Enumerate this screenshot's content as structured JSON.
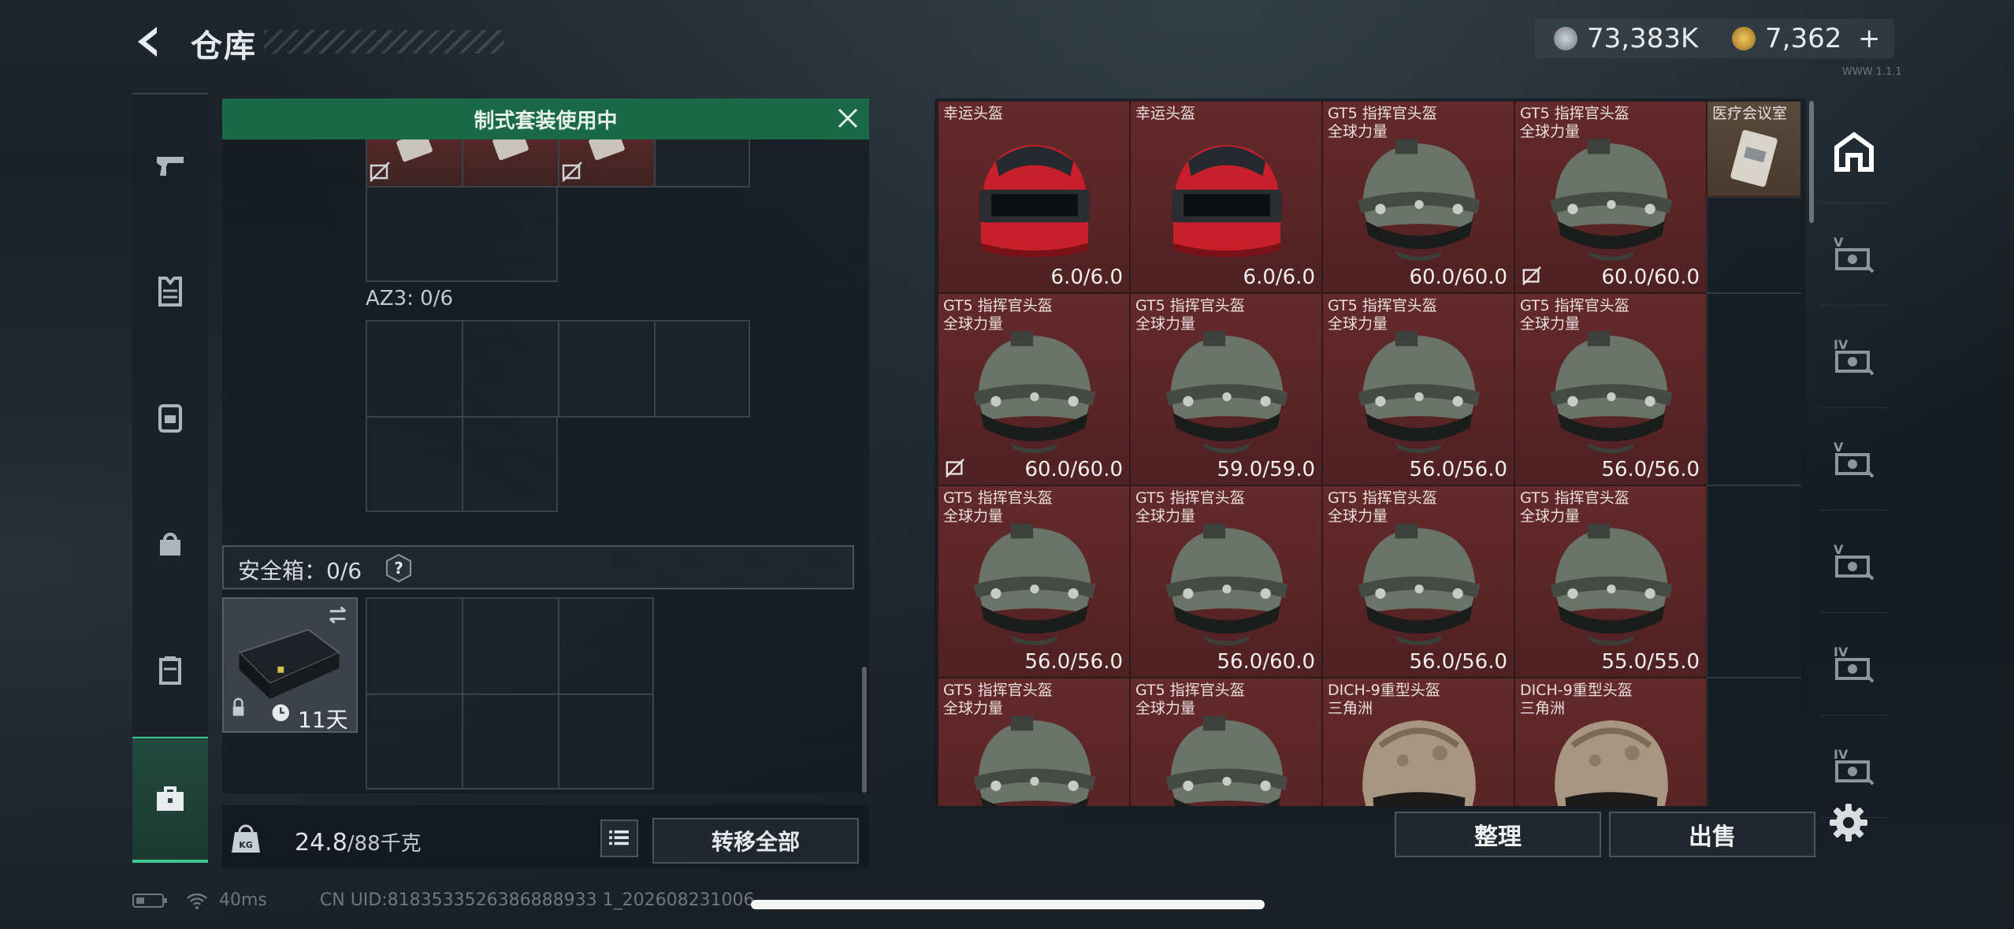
{
  "header": {
    "title": "仓库",
    "back_icon": "back-arrow-icon"
  },
  "currency": {
    "silver_value": "73,383K",
    "gold_value": "7,362",
    "add_label": "+"
  },
  "left_nav": [
    "pistol-icon",
    "vest-icon",
    "backpack-icon",
    "bag-icon",
    "case-icon",
    "toolbox-icon"
  ],
  "banner": {
    "text": "制式套装使用中"
  },
  "az3": {
    "label": "AZ3: 0/6"
  },
  "safe_box": {
    "label": "安全箱：0/6",
    "help": "?",
    "timer": "11天"
  },
  "footer_left": {
    "weight": "24.8",
    "capacity": "/88千克",
    "transfer_label": "转移全部"
  },
  "items": [
    {
      "name": "幸运头盔",
      "sub": "",
      "dur": "6.0/6.0",
      "helmet": "red",
      "no_insure": false
    },
    {
      "name": "幸运头盔",
      "sub": "",
      "dur": "6.0/6.0",
      "helmet": "red",
      "no_insure": false
    },
    {
      "name": "GT5 指挥官头盔",
      "sub": "全球力量",
      "dur": "60.0/60.0",
      "helmet": "green",
      "no_insure": false
    },
    {
      "name": "GT5 指挥官头盔",
      "sub": "全球力量",
      "dur": "60.0/60.0",
      "helmet": "green",
      "no_insure": true
    },
    {
      "name": "GT5 指挥官头盔",
      "sub": "全球力量",
      "dur": "60.0/60.0",
      "helmet": "green",
      "no_insure": true
    },
    {
      "name": "GT5 指挥官头盔",
      "sub": "全球力量",
      "dur": "59.0/59.0",
      "helmet": "green",
      "no_insure": false
    },
    {
      "name": "GT5 指挥官头盔",
      "sub": "全球力量",
      "dur": "56.0/56.0",
      "helmet": "green",
      "no_insure": false
    },
    {
      "name": "GT5 指挥官头盔",
      "sub": "全球力量",
      "dur": "56.0/56.0",
      "helmet": "green",
      "no_insure": false
    },
    {
      "name": "GT5 指挥官头盔",
      "sub": "全球力量",
      "dur": "56.0/56.0",
      "helmet": "green",
      "no_insure": false
    },
    {
      "name": "GT5 指挥官头盔",
      "sub": "全球力量",
      "dur": "56.0/60.0",
      "helmet": "green",
      "no_insure": false
    },
    {
      "name": "GT5 指挥官头盔",
      "sub": "全球力量",
      "dur": "56.0/56.0",
      "helmet": "green",
      "no_insure": false
    },
    {
      "name": "GT5 指挥官头盔",
      "sub": "全球力量",
      "dur": "55.0/55.0",
      "helmet": "green",
      "no_insure": false
    },
    {
      "name": "GT5 指挥官头盔",
      "sub": "全球力量",
      "dur": "",
      "helmet": "green",
      "no_insure": false
    },
    {
      "name": "GT5 指挥官头盔",
      "sub": "全球力量",
      "dur": "",
      "helmet": "green",
      "no_insure": false
    },
    {
      "name": "DICH-9重型头盔",
      "sub": "三角洲",
      "dur": "",
      "helmet": "tan",
      "no_insure": false
    },
    {
      "name": "DICH-9重型头盔",
      "sub": "三角洲",
      "dur": "",
      "helmet": "tan",
      "no_insure": false
    }
  ],
  "side_item": {
    "name": "医疗会议室"
  },
  "right_nav": [
    "home-base-icon",
    "keycard-v-icon",
    "keycard-iv-icon",
    "keycard-v-icon",
    "keycard-v-icon",
    "keycard-iv-icon",
    "keycard-iv-icon"
  ],
  "actions": {
    "sort_label": "整理",
    "sell_label": "出售"
  },
  "status": {
    "ping": "40ms",
    "uid": "CN UID:8183533526386888933 1_202608231006"
  },
  "version": "WWW 1.1.1"
}
